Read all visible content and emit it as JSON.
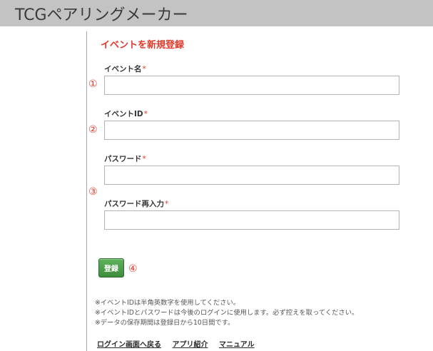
{
  "app": {
    "title": "TCGペアリングメーカー"
  },
  "form": {
    "heading": "イベントを新規登録",
    "required_mark": "*",
    "fields": [
      {
        "label": "イベント名",
        "value": "",
        "marker": "①"
      },
      {
        "label": "イベントID",
        "value": "",
        "marker": "②"
      },
      {
        "label": "パスワード",
        "value": ""
      },
      {
        "label": "パスワード再入力",
        "value": ""
      }
    ],
    "password_marker": "③",
    "submit_label": "登録",
    "submit_marker": "④"
  },
  "notes": [
    "※イベントIDは半角英数字を使用してください。",
    "※イベントIDとパスワードは今後のログインに使用します。必ず控えを取ってください。",
    "※データの保存期間は登録日から10日間です。"
  ],
  "footer": {
    "links": [
      "ログイン画面へ戻る",
      "アプリ紹介",
      "マニュアル"
    ]
  },
  "colors": {
    "header_bg": "#c3c3c3",
    "accent_red": "#e03a2a",
    "button_green": "#4a9a47"
  }
}
